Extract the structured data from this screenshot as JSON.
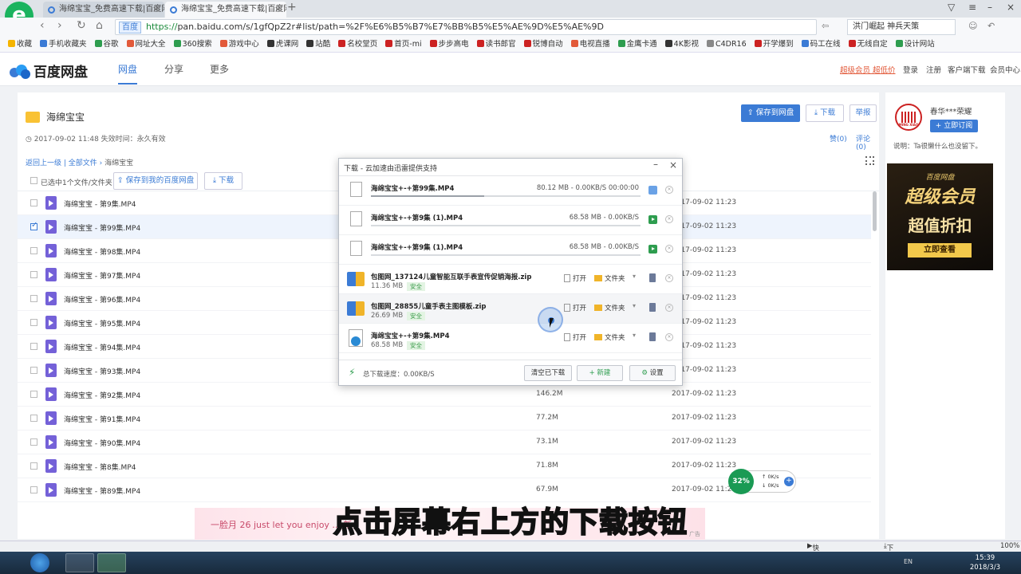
{
  "browser": {
    "tabs": [
      {
        "label": "海绵宝宝_免费高速下载|百度网盘",
        "active": false
      },
      {
        "label": "海绵宝宝_免费高速下载|百度网盘",
        "active": true
      }
    ],
    "url_badge": "百度",
    "url_scheme": "https://",
    "url_rest": "pan.baidu.com/s/1gfQpZ2r#list/path=%2F%E6%B5%B7%E7%BB%B5%E5%AE%9D%E5%AE%9D",
    "search_text": "洪门崛起 神兵天策",
    "bookmarks": [
      "收藏",
      "手机收藏夹",
      "谷歌",
      "网址大全",
      "360搜索",
      "游戏中心",
      "虎课网",
      "站酷",
      "名校堂页",
      "首页-mi",
      "步步高电",
      "读书郎官",
      "锐博自动",
      "电视直播",
      "金鹰卡通",
      "4K影视",
      "C4DR16",
      "开学爆到",
      "码工在线",
      "无线自定",
      "设计网站"
    ],
    "bookmark_colors": [
      "#f5b400",
      "#3b7bd5",
      "#2e9d4f",
      "#e25a3a",
      "#2e9d4f",
      "#e25a3a",
      "#333",
      "#333",
      "#c22",
      "#c22",
      "#c22",
      "#c22",
      "#c22",
      "#e25a3a",
      "#2e9d4f",
      "#333",
      "#888",
      "#c22",
      "#3b7bd5",
      "#c22",
      "#2e9d4f"
    ]
  },
  "header": {
    "logo": "百度网盘",
    "nav": [
      "网盘",
      "分享",
      "更多"
    ],
    "vip": "超级会员 超低价",
    "links": [
      "登录",
      "注册",
      "客户端下载",
      "会员中心"
    ]
  },
  "share": {
    "folder_name": "海绵宝宝",
    "meta": "2017-09-02 11:48    失效时间：永久有效",
    "save_button": "保存到网盘",
    "download_button": "下载",
    "report_button": "举报",
    "likes": "赞(0)",
    "comments": "评论(0)",
    "breadcrumb_back": "返回上一级",
    "breadcrumb_all": "全部文件",
    "breadcrumb_current": "海绵宝宝",
    "selected_text": "已选中1个文件/文件夹",
    "save_to_mine": "保存到我的百度网盘",
    "download_small": "下载"
  },
  "files": [
    {
      "name": "海绵宝宝 - 第9集.MP4",
      "size": "",
      "date": "2017-09-02 11:23",
      "selected": false
    },
    {
      "name": "海绵宝宝 - 第99集.MP4",
      "size": "",
      "date": "2017-09-02 11:23",
      "selected": true
    },
    {
      "name": "海绵宝宝 - 第98集.MP4",
      "size": "",
      "date": "2017-09-02 11:23",
      "selected": false
    },
    {
      "name": "海绵宝宝 - 第97集.MP4",
      "size": "",
      "date": "2017-09-02 11:23",
      "selected": false
    },
    {
      "name": "海绵宝宝 - 第96集.MP4",
      "size": "",
      "date": "2017-09-02 11:23",
      "selected": false
    },
    {
      "name": "海绵宝宝 - 第95集.MP4",
      "size": "",
      "date": "2017-09-02 11:23",
      "selected": false
    },
    {
      "name": "海绵宝宝 - 第94集.MP4",
      "size": "",
      "date": "2017-09-02 11:23",
      "selected": false
    },
    {
      "name": "海绵宝宝 - 第93集.MP4",
      "size": "",
      "date": "2017-09-02 11:23",
      "selected": false
    },
    {
      "name": "海绵宝宝 - 第92集.MP4",
      "size": "146.2M",
      "date": "2017-09-02 11:23",
      "selected": false
    },
    {
      "name": "海绵宝宝 - 第91集.MP4",
      "size": "77.2M",
      "date": "2017-09-02 11:23",
      "selected": false
    },
    {
      "name": "海绵宝宝 - 第90集.MP4",
      "size": "73.1M",
      "date": "2017-09-02 11:23",
      "selected": false
    },
    {
      "name": "海绵宝宝 - 第8集.MP4",
      "size": "71.8M",
      "date": "2017-09-02 11:23",
      "selected": false
    },
    {
      "name": "海绵宝宝 - 第89集.MP4",
      "size": "67.9M",
      "date": "2017-09-02 11:23",
      "selected": false
    }
  ],
  "sidebar": {
    "user_name": "春华***荣耀",
    "avatar_label": "MING XIAO",
    "subscribe": "+ 立即订阅",
    "desc": "说明：Ta很懒什么也没留下。",
    "ad_line1": "百度网盘",
    "ad_line2": "超级会员",
    "ad_line3": "超值折扣",
    "ad_button": "立即查看"
  },
  "dialog": {
    "title": "下载 - 云加速由迅雷提供支持",
    "items": [
      {
        "type": "doc",
        "name": "海绵宝宝+-+第99集.MP4",
        "progress_text": "80.12 MB - 0.00KB/S  00:00:00",
        "progress": 0.42,
        "state": "pause"
      },
      {
        "type": "doc",
        "name": "海绵宝宝+-+第9集 (1).MP4",
        "progress_text": "68.58 MB - 0.00KB/S",
        "progress": 0.0,
        "state": "play"
      },
      {
        "type": "doc",
        "name": "海绵宝宝+-+第9集 (1).MP4",
        "progress_text": "68.58 MB - 0.00KB/S",
        "progress": 0.0,
        "state": "play"
      },
      {
        "type": "zip",
        "name": "包图网_137124儿童智能互联手表宣传促销海报.zip",
        "size": "11.36 MB",
        "safe": "安全",
        "open": "打开",
        "folder": "文件夹"
      },
      {
        "type": "zip",
        "name": "包图网_28855儿童手表主图模板.zip",
        "size": "26.69 MB",
        "safe": "安全",
        "open": "打开",
        "folder": "文件夹"
      },
      {
        "type": "media",
        "name": "海绵宝宝+-+第9集.MP4",
        "size": "68.58 MB",
        "safe": "安全",
        "open": "打开",
        "folder": "文件夹"
      }
    ],
    "total_speed": "总下载速度：0.00KB/S",
    "clear_button": "清空已下载",
    "new_button": "+ 新建",
    "settings_button": "设置"
  },
  "speed_widget": {
    "percent": "32%",
    "up": "0K/s",
    "down": "0K/s"
  },
  "bottom_ad": {
    "text": "一脸月  26 just let you enjoy ... 新",
    "tag": "广告"
  },
  "caption": "点击屏幕右上方的下载按钮",
  "statusbar": {
    "left": "快剪辑",
    "download": "下载",
    "zoom": "100%"
  },
  "taskbar": {
    "lang": "EN",
    "time": "15:39",
    "date": "2018/3/3"
  }
}
